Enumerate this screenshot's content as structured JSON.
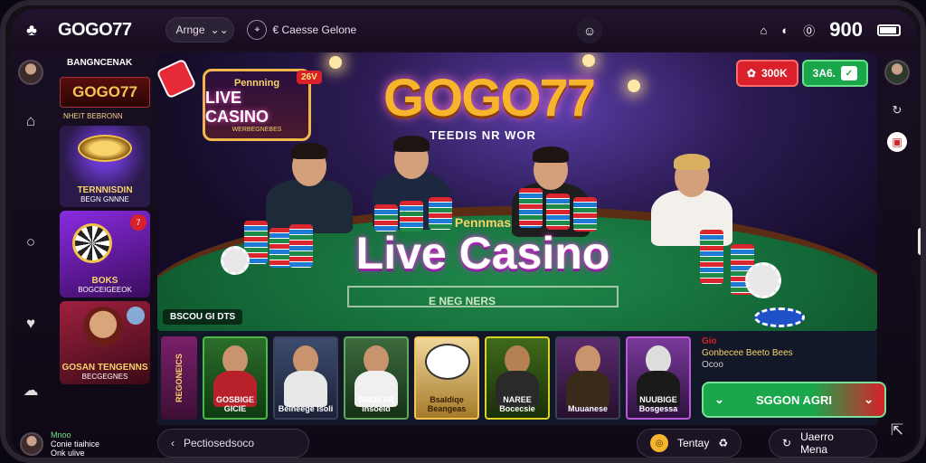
{
  "topbar": {
    "brand": "GOGO77",
    "lang_label": "Arnge",
    "lang_chevron": "⌄⌄",
    "location_label": "€ Caesse Gelone",
    "coins": "900",
    "icons": [
      "home-icon",
      "location-icon",
      "face-icon",
      "car-icon",
      "eye-mask-icon",
      "coin-icon",
      "battery-icon"
    ]
  },
  "promo": {
    "title": "BANGNCENAK",
    "logo": "GOGO77",
    "logo_sub": "NHEIT BEBRONN",
    "cards": [
      {
        "title": "TERNNISDIN",
        "sub": "BEGN GNNNE"
      },
      {
        "title": "BOKS",
        "sub": "BOGCEIGEEOK"
      },
      {
        "title": "GOSAN TENGENNS",
        "sub": "BECGEGNES"
      }
    ],
    "badge": "7"
  },
  "hero": {
    "sign_line1": "Pennning",
    "sign_line2": "LIVE CASINO",
    "sign_line3": "WERBEGNEBES",
    "sign_badge": "26V",
    "logo": "GOGO77",
    "tagline": "TEEDIS NR WOR",
    "title_pre": "Pennmas",
    "title": "Live Casino",
    "table_text": "E NEG NERS",
    "footer": "BSCOU GI DTS",
    "btn_red": "300K",
    "btn_green": "3A6."
  },
  "games": {
    "side_label": "REGONEICS",
    "items": [
      {
        "label": "GOSBIGE GICIE"
      },
      {
        "label": "Beineege Isoli"
      },
      {
        "label": "SMOKAR Insoeid"
      },
      {
        "label": "Bsaldiqe Beangeas"
      },
      {
        "label": "NAREE Bocecsie"
      },
      {
        "label": "Muuanese"
      },
      {
        "label": "NUUBIGE Bosgessa"
      }
    ],
    "info_tag": "Gio",
    "info_title": "Gonbecee Beeto Bees",
    "info_sub": "Ocoo",
    "cta": "SGGON AGRI"
  },
  "bottom": {
    "search_label": "Pectiosedsoco",
    "btn1": "Tentay",
    "btn2": "Uaerro Mena",
    "user_status": "Mnoo",
    "user_name": "Conie tiaihice",
    "user_sub": "Onk ulive"
  }
}
